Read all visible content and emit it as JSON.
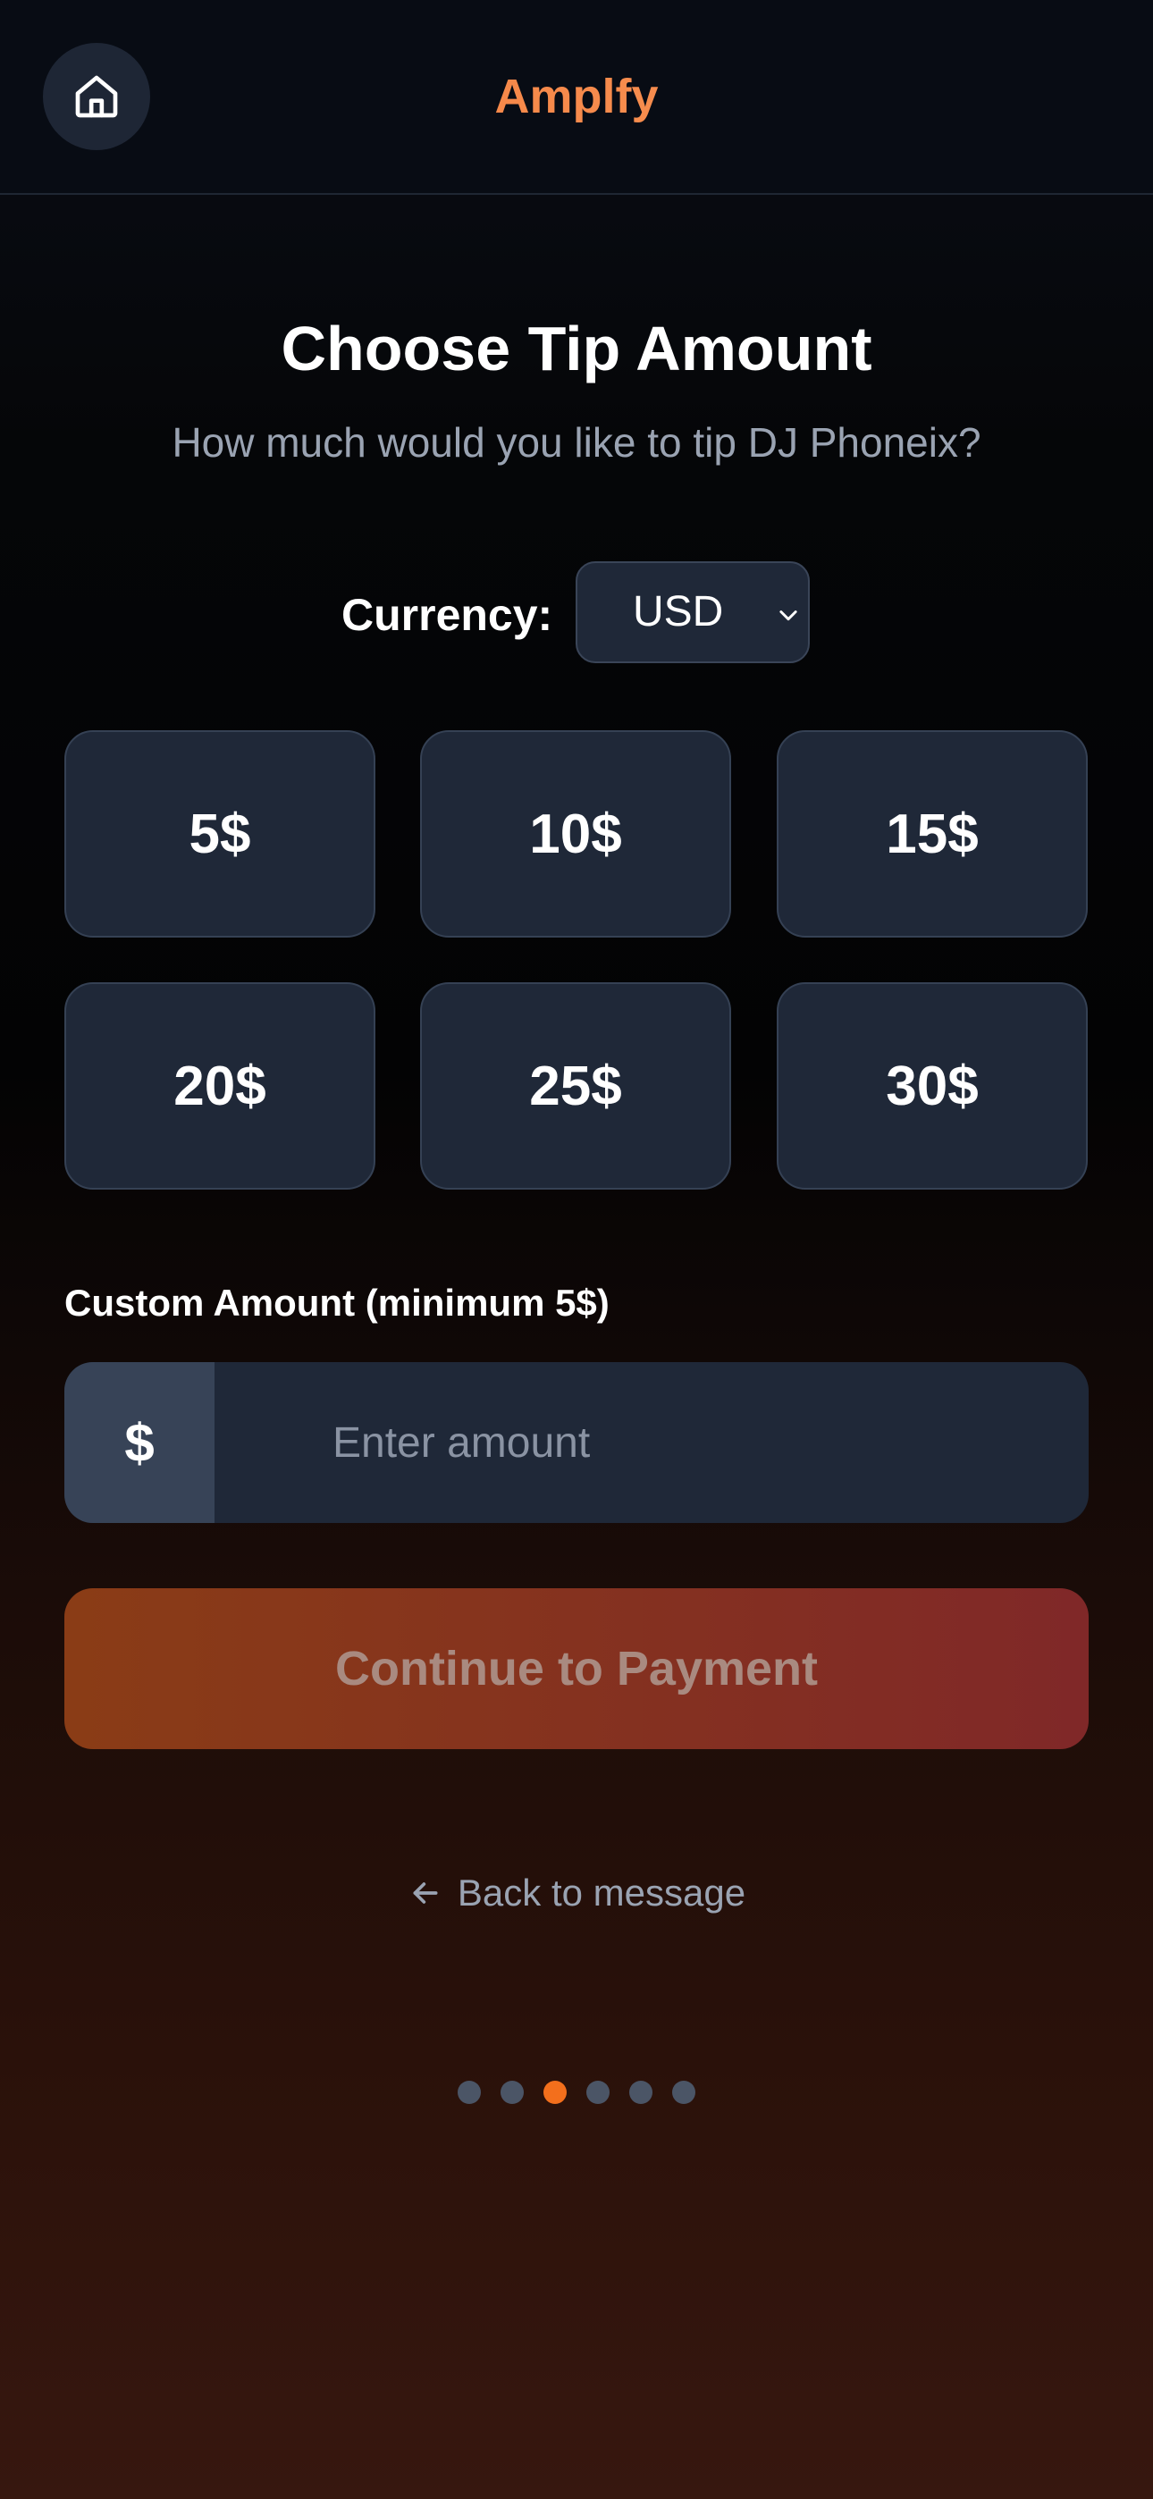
{
  "header": {
    "app_name": "Amplfy",
    "home_icon": "home-icon"
  },
  "main": {
    "title": "Choose Tip Amount",
    "subtitle": "How much would you like to tip DJ Phoneix?",
    "currency": {
      "label": "Currency:",
      "selected": "USD",
      "chevron_icon": "chevron-down-icon"
    },
    "preset_amounts": [
      "5$",
      "10$",
      "15$",
      "20$",
      "25$",
      "30$"
    ],
    "custom": {
      "label": "Custom Amount (minimum 5$)",
      "prefix": "$",
      "placeholder": "Enter amount",
      "value": ""
    },
    "continue_label": "Continue to Payment",
    "back_label": "Back to message",
    "back_icon": "arrow-left-icon"
  },
  "progress": {
    "total_steps": 6,
    "current_step": 3
  },
  "colors": {
    "accent": "#f36f1c",
    "brand_text": "#f57e3d",
    "card_bg": "#1f2838",
    "continue_gradient_start": "#8a3c16",
    "continue_gradient_end": "#802828"
  }
}
